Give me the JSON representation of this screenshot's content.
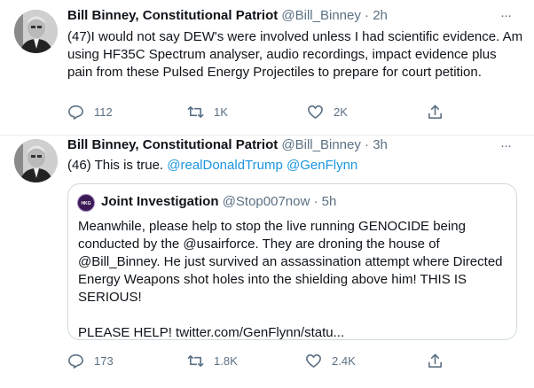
{
  "tweets": [
    {
      "name": "Bill Binney, Constitutional Patriot",
      "handle": "@Bill_Binney",
      "separator": "·",
      "time": "2h",
      "text": "(47)I would not say DEW's were involved unless I had scientific evidence. Am using HF35C Spectrum analyser, audio recordings, impact evidence plus pain from these Pulsed Energy Projectiles to prepare for court petition.",
      "reply_count": "112",
      "retweet_count": "1K",
      "like_count": "2K"
    },
    {
      "name": "Bill Binney, Constitutional Patriot",
      "handle": "@Bill_Binney",
      "separator": "·",
      "time": "3h",
      "text_prefix": "(46) This is true. ",
      "mention1": "@realDonaldTrump",
      "mention2": "@GenFlynn",
      "quote": {
        "avatar_text": "HKG",
        "name": "Joint Investigation",
        "handle": "@Stop007now",
        "separator": "·",
        "time": "5h",
        "text": "Meanwhile, please help to stop the live running GENOCIDE being conducted by the @usairforce. They are droning the house of @Bill_Binney. He just survived an assassination attempt where Directed Energy Weapons shot holes into the shielding above him! THIS IS SERIOUS!",
        "text2": "PLEASE HELP! twitter.com/GenFlynn/statu..."
      },
      "reply_count": "173",
      "retweet_count": "1.8K",
      "like_count": "2.4K"
    }
  ],
  "more_label": "···",
  "icons": [
    "reply-icon",
    "retweet-icon",
    "like-icon",
    "share-icon",
    "more-icon"
  ],
  "colors": {
    "link": "#1b95e0",
    "secondary": "#5b7083",
    "border": "#e6ecf0"
  }
}
